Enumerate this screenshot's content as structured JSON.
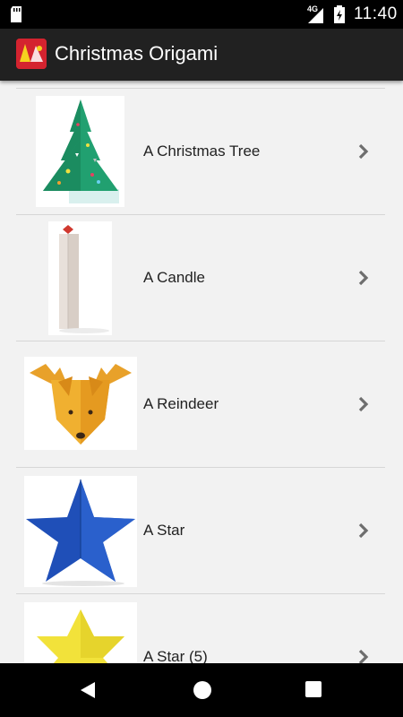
{
  "status_bar": {
    "time": "11:40",
    "network": "4G"
  },
  "app_bar": {
    "title": "Christmas Origami"
  },
  "items": [
    {
      "label": "A Christmas Tree",
      "thumb_icon": "christmas-tree-origami"
    },
    {
      "label": "A Candle",
      "thumb_icon": "candle-origami"
    },
    {
      "label": "A Reindeer",
      "thumb_icon": "reindeer-origami"
    },
    {
      "label": "A Star",
      "thumb_icon": "blue-star-origami"
    },
    {
      "label": "A Star (5)",
      "thumb_icon": "yellow-star-origami"
    }
  ],
  "colors": {
    "app_bar": "#212121",
    "list_background": "#f2f2f2",
    "tree_green": "#1e9a6b",
    "star_blue": "#1f4fb8",
    "star_yellow": "#f2e23a",
    "reindeer_orange": "#e8a12a"
  }
}
